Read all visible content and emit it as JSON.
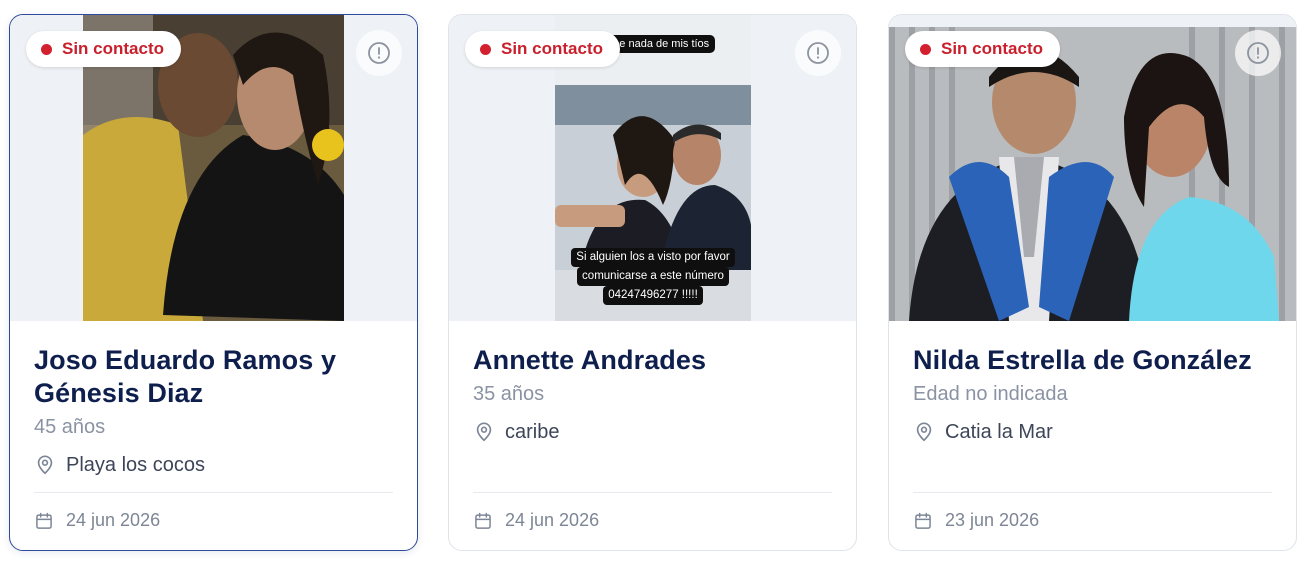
{
  "cards": [
    {
      "status": "Sin contacto",
      "name": "Joso Eduardo Ramos y Génesis Diaz",
      "age": "45 años",
      "location": "Playa los cocos",
      "date": "24 jun 2026"
    },
    {
      "status": "Sin contacto",
      "name": "Annette Andrades",
      "age": "35 años",
      "location": "caribe",
      "date": "24 jun 2026",
      "photo_text": {
        "top": "Yo no se nada de mis tíos",
        "bottom_line1": "Si alguien los a visto por favor",
        "bottom_line2": "comunicarse a este número",
        "bottom_line3": "04247496277 !!!!!"
      }
    },
    {
      "status": "Sin contacto",
      "name": "Nilda Estrella de González",
      "age": "Edad no indicada",
      "location": "Catia la Mar",
      "date": "23 jun 2026"
    }
  ],
  "colors": {
    "status_red": "#d3202f",
    "title_navy": "#0f1f4d",
    "muted": "#8a93a3",
    "active_border": "#2f4a9a"
  },
  "icons": [
    "alert-circle-icon",
    "map-pin-icon",
    "calendar-icon"
  ]
}
